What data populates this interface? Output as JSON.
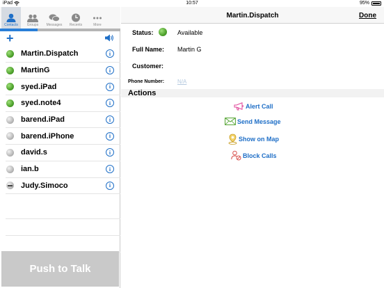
{
  "statusbar": {
    "carrier": "iPad",
    "time": "10:57",
    "battery": "95%"
  },
  "tabs": [
    {
      "label": "Contacts",
      "icon": "person-icon",
      "active": true
    },
    {
      "label": "Groups",
      "icon": "group-icon",
      "active": false
    },
    {
      "label": "Messages",
      "icon": "messages-icon",
      "active": false
    },
    {
      "label": "Recents",
      "icon": "recents-icon",
      "active": false
    },
    {
      "label": "More",
      "icon": "more-icon",
      "active": false
    }
  ],
  "progress": 0.31,
  "contacts": [
    {
      "name": "Martin.Dispatch",
      "status": "green"
    },
    {
      "name": "MartinG",
      "status": "green"
    },
    {
      "name": "syed.iPad",
      "status": "green"
    },
    {
      "name": "syed.note4",
      "status": "green"
    },
    {
      "name": "barend.iPad",
      "status": "grey"
    },
    {
      "name": "barend.iPhone",
      "status": "grey"
    },
    {
      "name": "david.s",
      "status": "grey"
    },
    {
      "name": "ian.b",
      "status": "grey"
    },
    {
      "name": "Judy.Simoco",
      "status": "dnd"
    }
  ],
  "ptt_label": "Push to Talk",
  "detail": {
    "title": "Martin.Dispatch",
    "done_label": "Done",
    "status_label": "Status:",
    "status_value": "Available",
    "fullname_label": "Full Name:",
    "fullname_value": "Martin G",
    "customer_label": "Customer:",
    "phone_label": "Phone Number:",
    "phone_value": "N/A",
    "actions_heading": "Actions",
    "actions": [
      {
        "label": "Alert Call",
        "icon": "megaphone-icon"
      },
      {
        "label": "Send Message",
        "icon": "envelope-icon"
      },
      {
        "label": "Show on Map",
        "icon": "map-pin-icon"
      },
      {
        "label": "Block Calls",
        "icon": "block-user-icon"
      }
    ]
  },
  "colors": {
    "accent": "#1f6fc7",
    "available": "#4ea12c",
    "offline": "#b9b9b9",
    "ptt_bg": "#c9c9c9"
  }
}
